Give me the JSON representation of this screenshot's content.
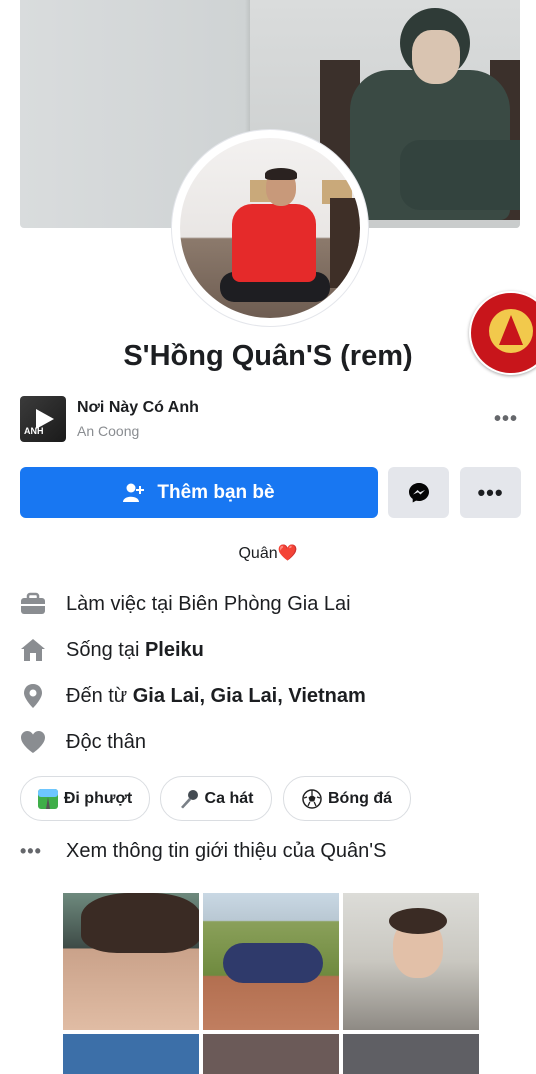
{
  "profile": {
    "name": "S'Hồng Quân'S (rem)",
    "bio_text": "Quân",
    "bio_emoji": "❤️"
  },
  "music": {
    "title": "Nơi Này Có Anh",
    "artist": "An Coong",
    "more": "•••",
    "thumb_text": "ANH"
  },
  "actions": {
    "add_friend_label": "Thêm bạn bè",
    "more_label": "•••"
  },
  "intro": {
    "work_prefix": "Làm việc tại Biên Phòng Gia Lai",
    "lives_prefix": "Sống tại ",
    "lives_place": "Pleiku",
    "from_prefix": "Đến từ ",
    "from_place": "Gia Lai, Gia Lai, Vietnam",
    "relationship": "Độc thân"
  },
  "hobbies": [
    {
      "label": "Đi phượt",
      "icon": "road-trip-icon"
    },
    {
      "label": "Ca hát",
      "icon": "microphone-icon"
    },
    {
      "label": "Bóng đá",
      "icon": "soccer-ball-icon"
    }
  ],
  "see_about": {
    "dots": "•••",
    "label": "Xem thông tin giới thiệu của Quân'S"
  },
  "colors": {
    "primary": "#1877f2",
    "secondary_button": "#e4e6eb",
    "icon_gray": "#65676b",
    "badge_red": "#c8151b"
  }
}
